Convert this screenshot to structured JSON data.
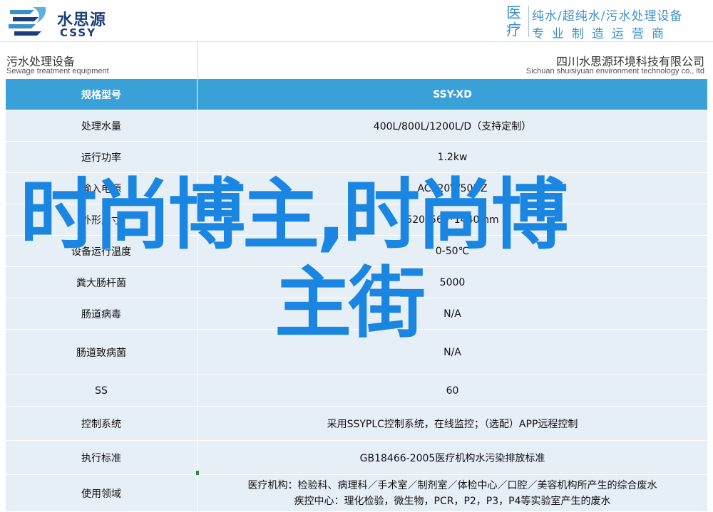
{
  "header": {
    "logo_cn": "水思源",
    "logo_en": "CSSY",
    "tagline_big": "医疗",
    "tagline_line1": "纯水/超纯水/污水处理设备",
    "tagline_line2": "专业制造运营商"
  },
  "subheader": {
    "left_cn": "污水处理设备",
    "left_en": "Sewage treatment equipment",
    "right_cn": "四川水思源环境科技有限公司",
    "right_en": "Sichuan shuisiyuan environment technology co., ltd"
  },
  "table": {
    "header": {
      "label": "规格型号",
      "value": "SSY-XD"
    },
    "rows": [
      {
        "label": "处理水量",
        "value": "400L/800L/1200L/D（支持定制）"
      },
      {
        "label": "运行功率",
        "value": "1.2kw"
      },
      {
        "label": "输入电源",
        "value": "AC220V/50HZ"
      },
      {
        "label": "外形尺寸",
        "value": "520*560*1440mm"
      },
      {
        "label": "设备运行温度",
        "value": "0-50℃"
      },
      {
        "label": "粪大肠杆菌",
        "value": "5000"
      },
      {
        "label": "肠道病毒",
        "value": "N/A"
      },
      {
        "label": "肠道致病菌",
        "value": "N/A"
      },
      {
        "label": "SS",
        "value": "60"
      },
      {
        "label": "控制系统",
        "value": "采用SSYPLC控制系统，在线监控；（选配）APP远程控制"
      },
      {
        "label": "执行标准",
        "value": "GB18466-2005医疗机构水污染排放标准"
      },
      {
        "label": "使用领域",
        "value_line1": "医疗机构：检验科、病理科／手术室／制剂室／体检中心／口腔／美容机构所产生的综合废水",
        "value_line2": "疾控中心：理化检验，微生物，PCR，P2，P3，P4等实验室产生的废水"
      }
    ]
  },
  "watermark": {
    "line1": "时尚博主,时尚博",
    "line2": "主街"
  }
}
